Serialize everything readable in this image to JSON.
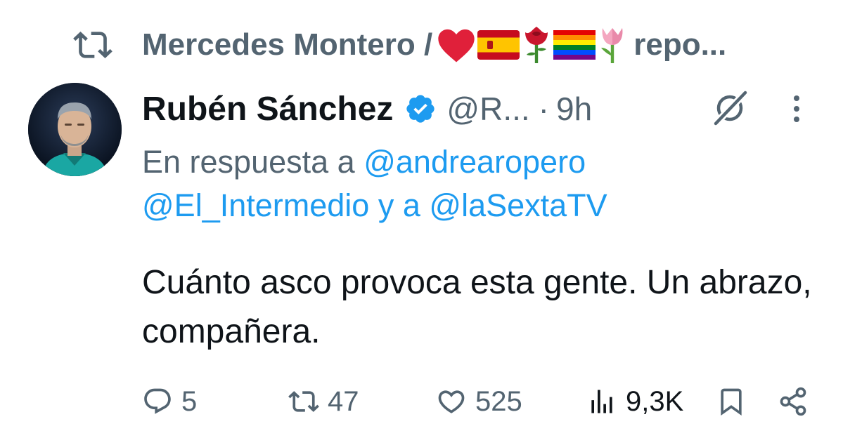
{
  "repost": {
    "icon": "repost-icon",
    "name": "Mercedes Montero /",
    "emojis": [
      "❤️",
      "🇪🇸",
      "🌹",
      "🏳️‍🌈",
      "🌷"
    ],
    "suffix": "repo..."
  },
  "author": {
    "name": "Rubén Sánchez",
    "verified": true,
    "handle": "@R...",
    "separator": "·",
    "time": "9h"
  },
  "reply_to": {
    "prefix": "En respuesta a",
    "mention_1": "@andrearopero",
    "mention_2": "@El_Intermedio",
    "connector": "y a",
    "mention_3": "@laSextaTV"
  },
  "tweet": {
    "text": "Cuánto asco provoca esta gente. Un abrazo, compañera."
  },
  "actions": {
    "replies": "5",
    "reposts": "47",
    "likes": "525",
    "views": "9,3K"
  },
  "colors": {
    "accent": "#1d9bf0",
    "secondary_text": "#536471",
    "primary_text": "#0f1419"
  }
}
